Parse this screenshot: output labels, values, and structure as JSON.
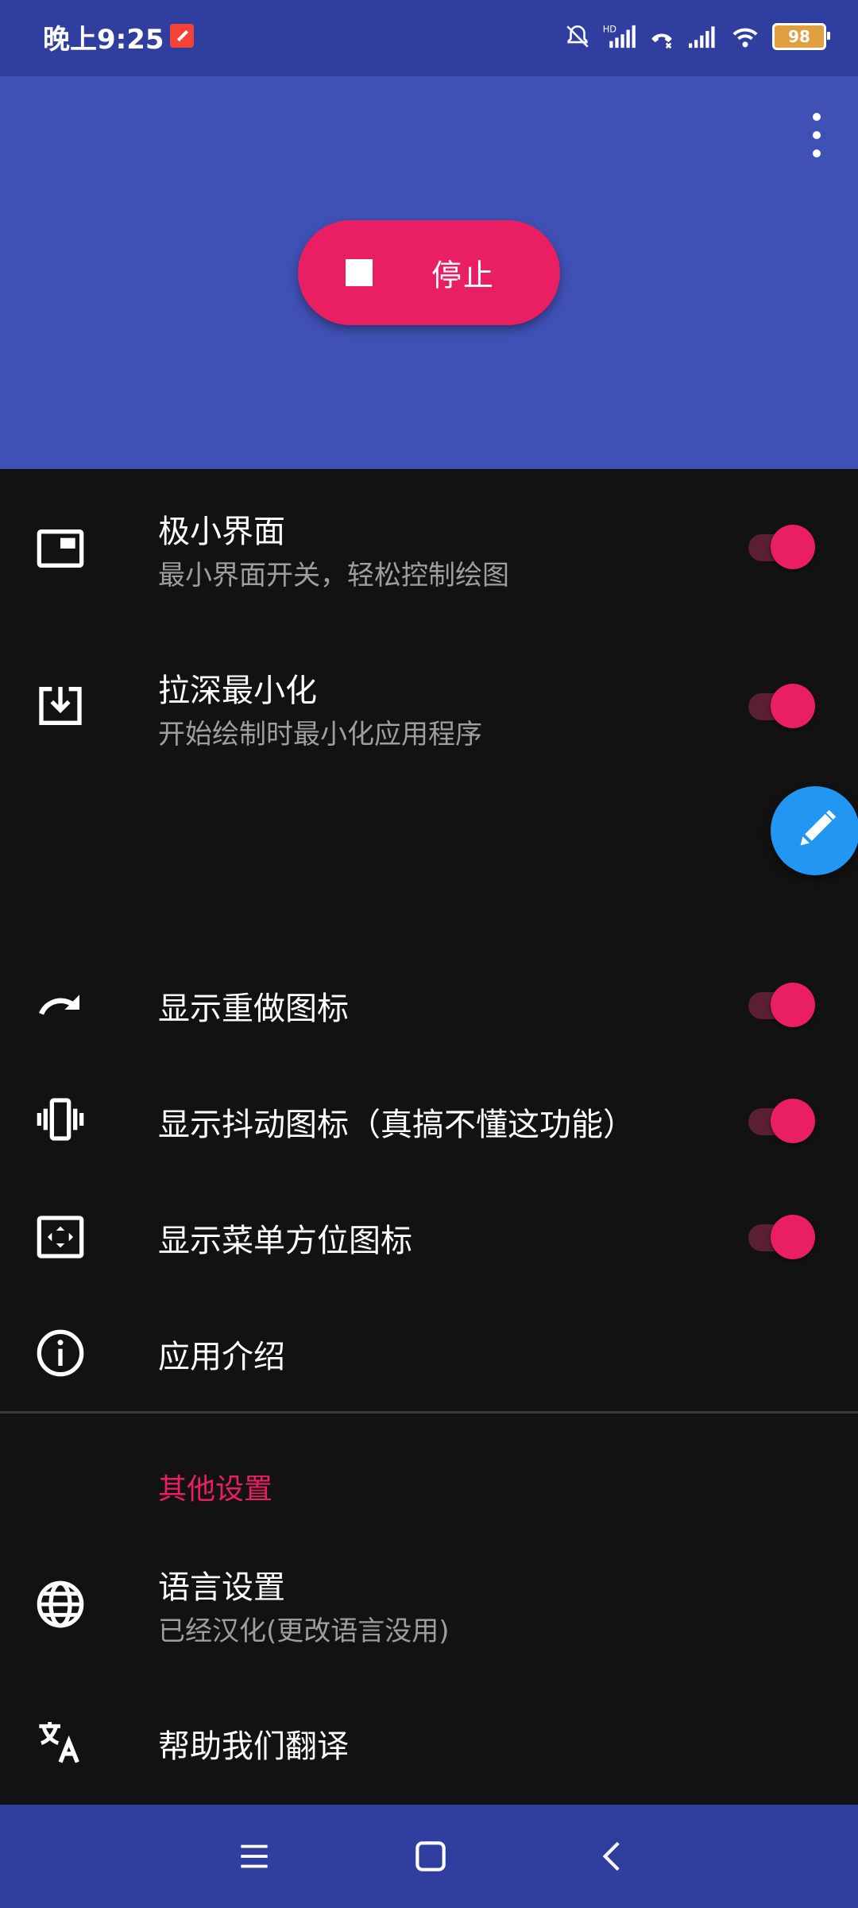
{
  "status_bar": {
    "time": "晚上9:25",
    "battery_level": "98"
  },
  "header": {
    "stop_button_label": "停止"
  },
  "settings": [
    {
      "id": "mini",
      "title": "极小界面",
      "subtitle": "最小界面开关，轻松控制绘图",
      "toggle": true,
      "icon": "picture-in-picture-icon"
    },
    {
      "id": "minimize",
      "title": "拉深最小化",
      "subtitle": "开始绘制时最小化应用程序",
      "toggle": true,
      "icon": "download-box-icon"
    },
    {
      "id": "redo",
      "title": "显示重做图标",
      "toggle": true,
      "icon": "redo-icon"
    },
    {
      "id": "vibrate",
      "title": "显示抖动图标（真搞不懂这功能）",
      "toggle": true,
      "icon": "vibrate-icon"
    },
    {
      "id": "menu-position",
      "title": "显示菜单方位图标",
      "toggle": true,
      "icon": "fullscreen-icon"
    },
    {
      "id": "about",
      "title": "应用介绍",
      "icon": "info-icon"
    }
  ],
  "other_section": {
    "title": "其他设置",
    "items": [
      {
        "id": "language",
        "title": "语言设置",
        "subtitle": "已经汉化(更改语言没用)",
        "icon": "globe-icon"
      },
      {
        "id": "translate",
        "title": "帮助我们翻译",
        "icon": "translate-icon"
      }
    ]
  },
  "colors": {
    "primary": "#3f51b5",
    "primary_dark": "#303f9f",
    "accent": "#e91e63",
    "fab": "#2196f3",
    "background": "#121212"
  }
}
